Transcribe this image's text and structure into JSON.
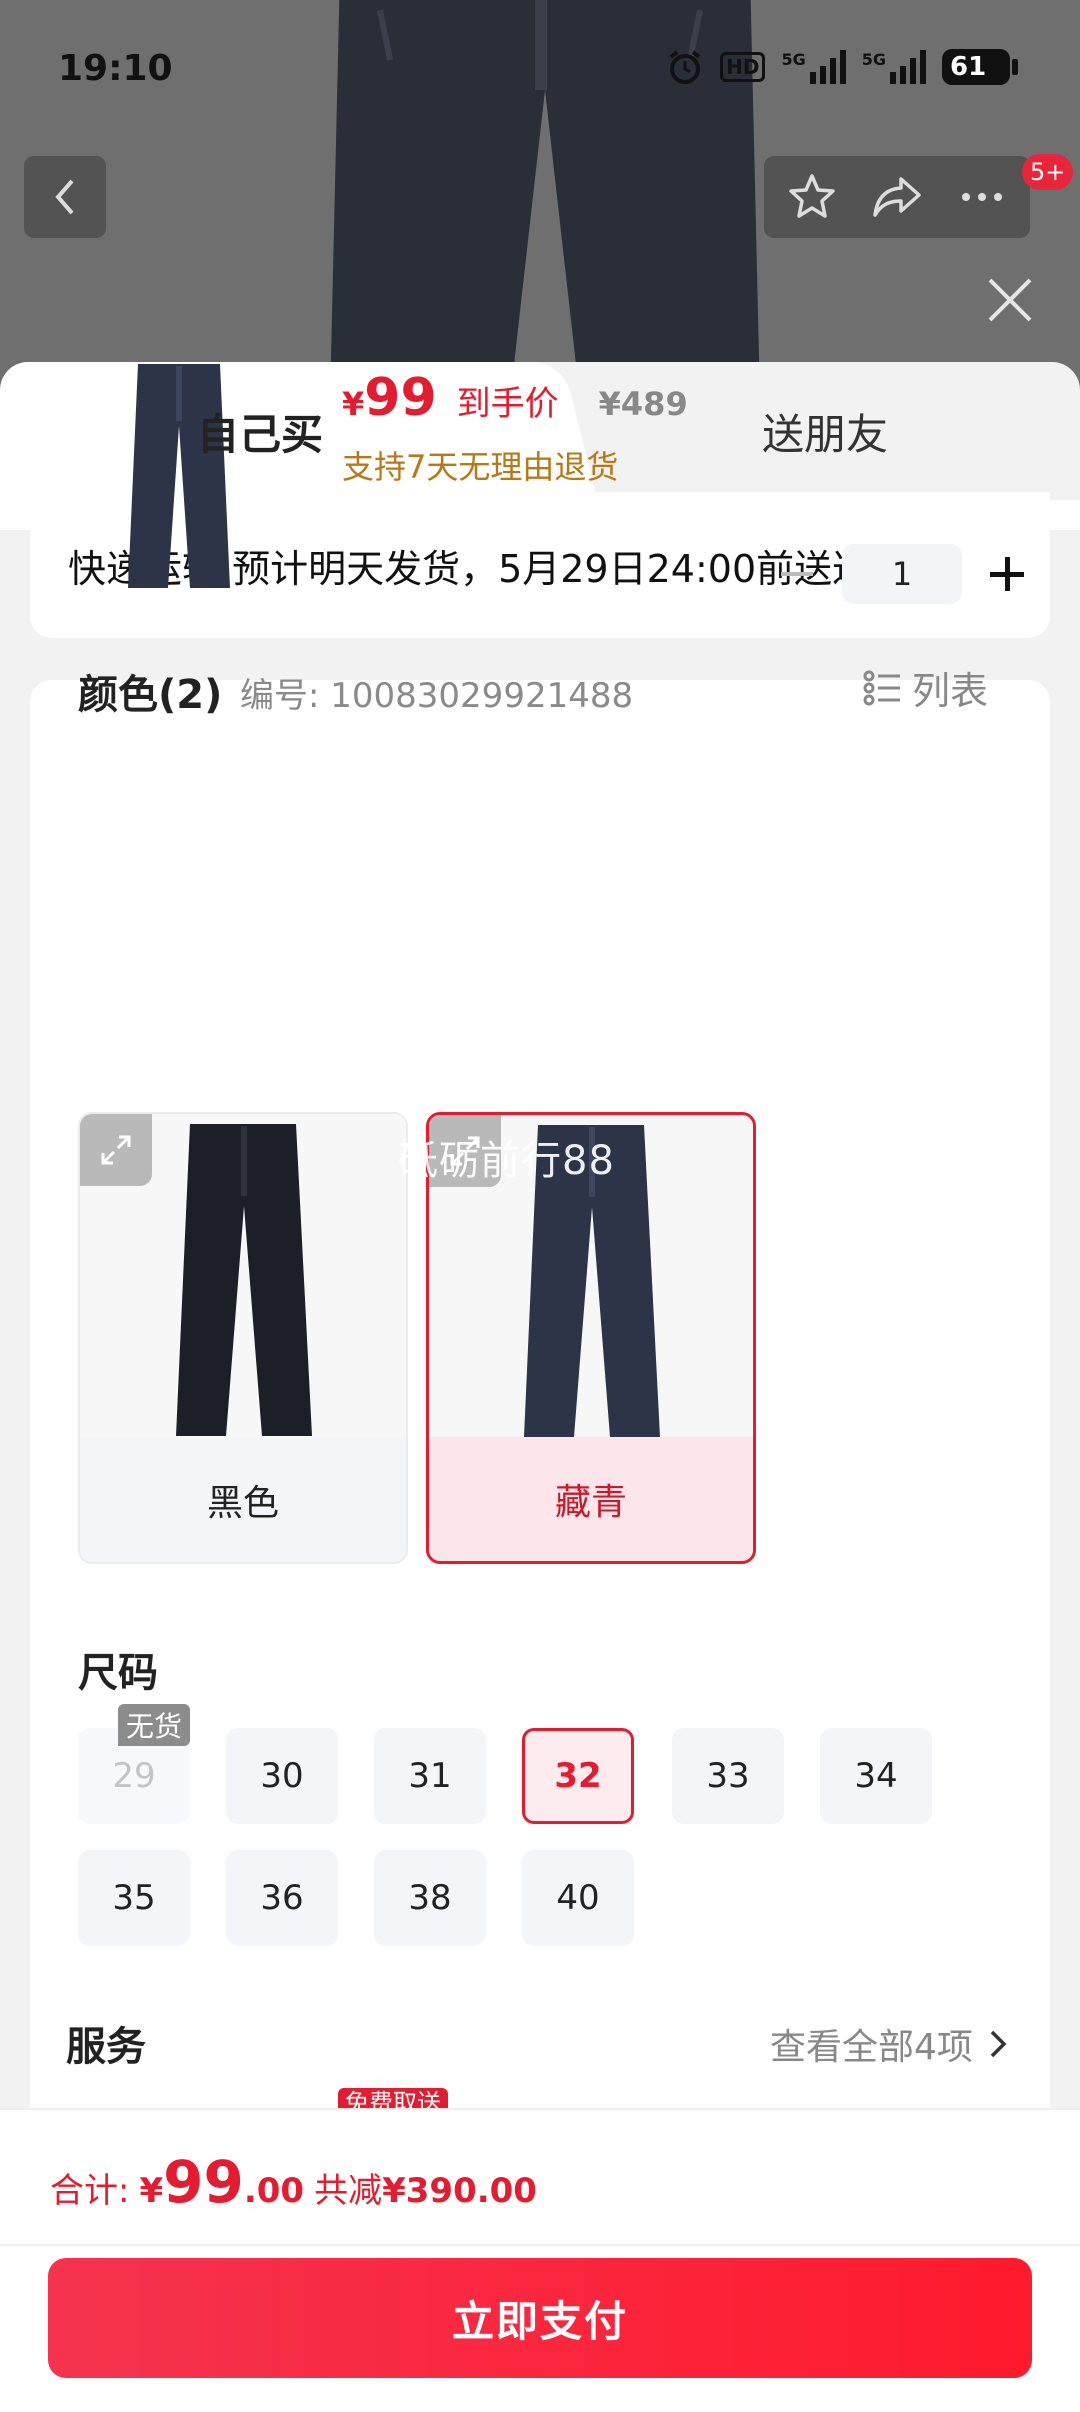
{
  "status_bar": {
    "time": "19:10",
    "battery": "61",
    "network_1": "5G",
    "network_2": "5G",
    "hd": "HD"
  },
  "header": {
    "cart_badge": "5+"
  },
  "tabs": [
    {
      "label": "自己买",
      "active": true
    },
    {
      "label": "送朋友",
      "active": false
    }
  ],
  "delivery": {
    "text": "快递运输 预计明天发货，5月29日24:00前送达"
  },
  "product": {
    "price_symbol": "¥",
    "price": "99",
    "price_label": "到手价",
    "original_price": "¥489",
    "return_policy": "支持7天无理由退货",
    "quantity": "1"
  },
  "color_section": {
    "title": "颜色(2)",
    "sku": "编号: 10083029921488",
    "list_toggle": "列表",
    "options": [
      {
        "label": "黑色",
        "selected": false
      },
      {
        "label": "藏青",
        "selected": true
      }
    ],
    "watermark": "砥砺前行88"
  },
  "size_section": {
    "title": "尺码",
    "stock_tag": "无货",
    "sizes": [
      {
        "label": "29",
        "state": "disabled"
      },
      {
        "label": "30",
        "state": "normal"
      },
      {
        "label": "31",
        "state": "normal"
      },
      {
        "label": "32",
        "state": "selected"
      },
      {
        "label": "33",
        "state": "normal"
      },
      {
        "label": "34",
        "state": "normal"
      },
      {
        "label": "35",
        "state": "normal"
      },
      {
        "label": "36",
        "state": "normal"
      },
      {
        "label": "38",
        "state": "normal"
      },
      {
        "label": "40",
        "state": "normal"
      }
    ]
  },
  "service": {
    "title": "服务",
    "view_all": "查看全部4项",
    "free_tag": "免费取送"
  },
  "footer": {
    "total_label": "合计:",
    "total_symbol": "¥",
    "total_int": "99",
    "total_dec": ".00",
    "savings_prefix": "共减",
    "savings": "¥390.00",
    "pay_button": "立即支付"
  },
  "colors": {
    "accent": "#e31d2f",
    "price_gold": "#b97815",
    "pants_navy": "#2c3447",
    "pants_black": "#1c1f27"
  }
}
